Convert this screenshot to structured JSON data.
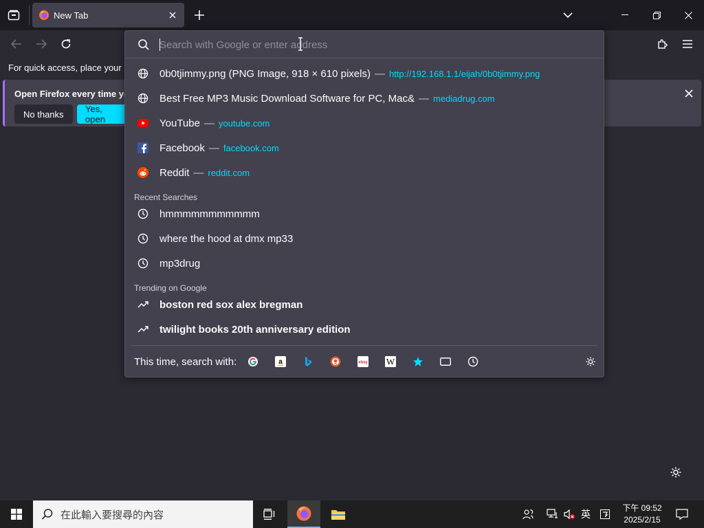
{
  "browser": {
    "tab_title": "New Tab",
    "bookmarks_hint": "For quick access, place your bo"
  },
  "notification": {
    "text": "Open Firefox every time you",
    "no_label": "No thanks",
    "yes_label": "Yes, open"
  },
  "urlbar": {
    "placeholder": "Search with Google or enter address",
    "value": ""
  },
  "suggestions": [
    {
      "label": "0b0tjimmy.png (PNG Image, 918 × 610 pixels)",
      "url": "http://192.168.1.1/eijah/0b0tjimmy.png",
      "icon": "globe-icon"
    },
    {
      "label": "Best Free MP3 Music Download Software for PC, Mac ",
      "label_fade": "&",
      "url": "mediadrug.com",
      "icon": "globe-icon"
    },
    {
      "label": "YouTube",
      "url": "youtube.com",
      "icon": "youtube-icon"
    },
    {
      "label": "Facebook",
      "url": "facebook.com",
      "icon": "facebook-icon"
    },
    {
      "label": "Reddit",
      "url": "reddit.com",
      "icon": "reddit-icon"
    }
  ],
  "recent_searches": {
    "heading": "Recent Searches",
    "items": [
      "hmmmmmmmmmmm",
      "where the hood at dmx mp33",
      "mp3drug"
    ]
  },
  "trending": {
    "heading": "Trending on Google",
    "items": [
      "boston red sox alex bregman",
      "twilight books 20th anniversary edition"
    ]
  },
  "oneoff": {
    "label": "This time, search with:",
    "engines": [
      "google-icon",
      "amazon-icon",
      "bing-icon",
      "duckduckgo-icon",
      "ebay-icon",
      "wikipedia-icon",
      "bookmarks-star-icon",
      "tabs-icon",
      "history-icon"
    ]
  },
  "taskbar": {
    "search_placeholder": "在此輸入要搜尋的內容",
    "ime_label": "英",
    "time": "下午 09:52",
    "date": "2025/2/15"
  },
  "colors": {
    "accent": "#00ddff",
    "popup_bg": "#42414d",
    "page_bg": "#2b2a33",
    "tabbar_bg": "#1c1b22"
  }
}
